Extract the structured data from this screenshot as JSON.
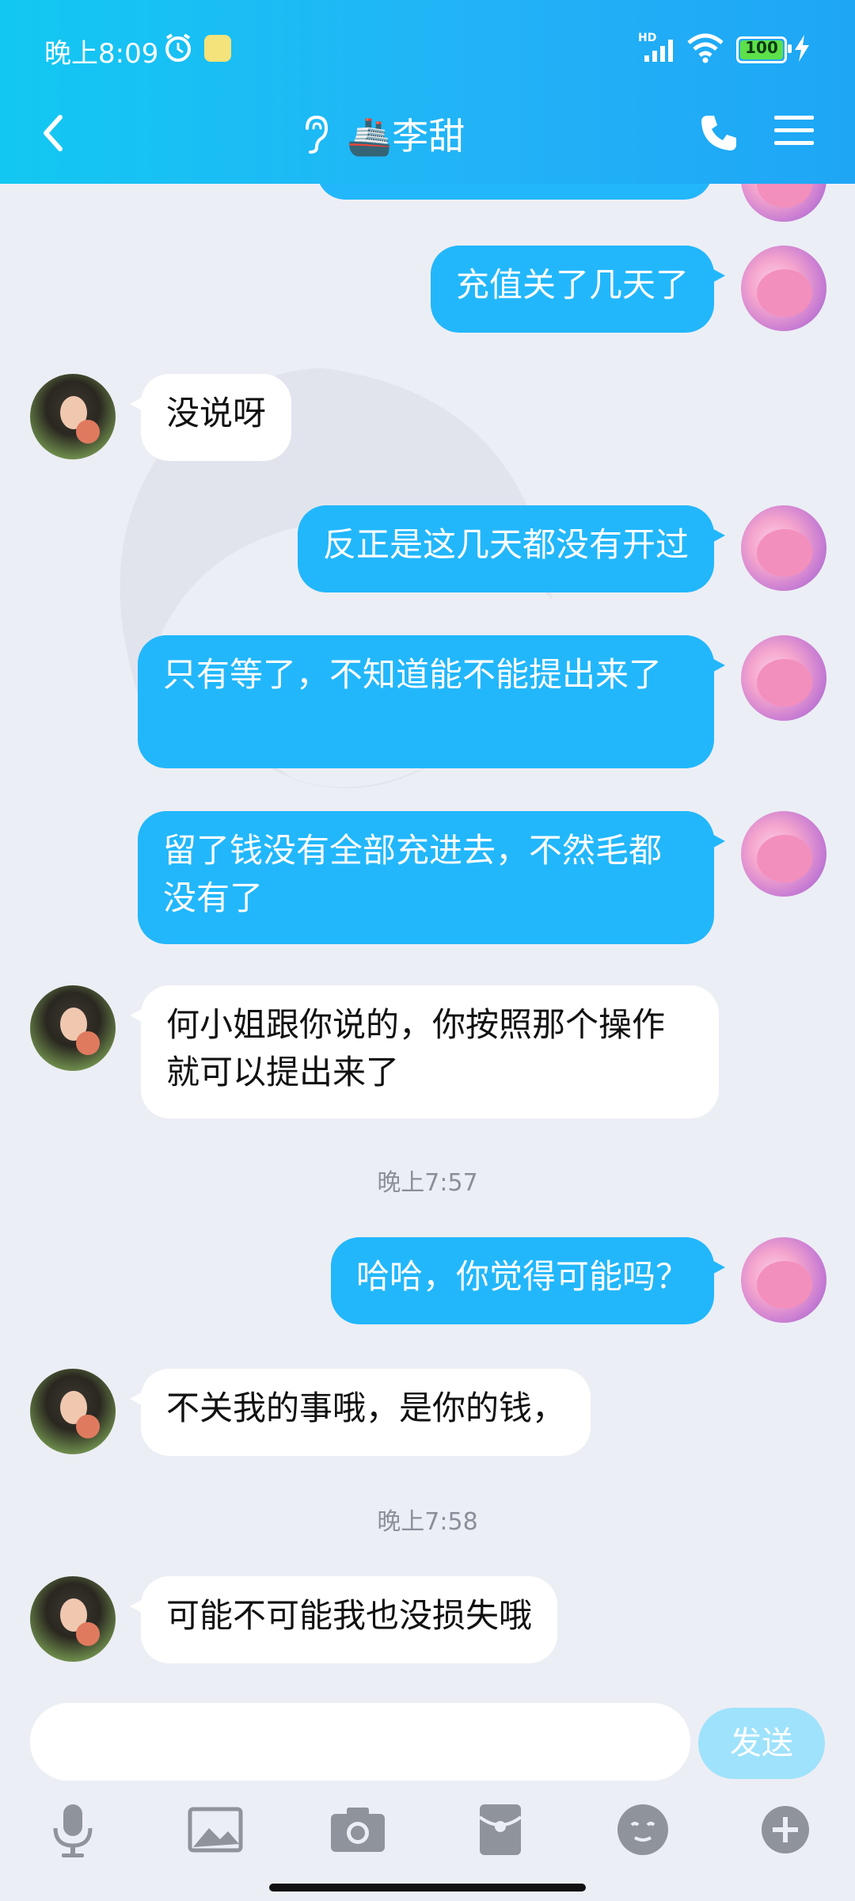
{
  "status_bar": {
    "time": "晚上8:09",
    "network": "HD",
    "battery": "100"
  },
  "header": {
    "title": "🚢李甜"
  },
  "messages": [
    {
      "from": "self",
      "text": "充值关了几天了"
    },
    {
      "from": "other",
      "text": "没说呀"
    },
    {
      "from": "self",
      "text": "反正是这几天都没有开过"
    },
    {
      "from": "self",
      "text": "只有等了，不知道能不能提出来了"
    },
    {
      "from": "self",
      "text": "留了钱没有全部充进去，不然毛都没有了"
    },
    {
      "from": "other",
      "text": "何小姐跟你说的，你按照那个操作就可以提出来了"
    },
    {
      "timestamp": "晚上7:57"
    },
    {
      "from": "self",
      "text": "哈哈，你觉得可能吗？"
    },
    {
      "from": "other",
      "text": "不关我的事哦，是你的钱，"
    },
    {
      "timestamp": "晚上7:58"
    },
    {
      "from": "other",
      "text": "可能不可能我也没损失哦"
    }
  ],
  "input": {
    "placeholder": "",
    "send_label": "发送"
  },
  "colors": {
    "header": "#1fb3f7",
    "self_bubble": "#22b7fb",
    "other_bubble": "#ffffff",
    "background": "#eceef5"
  },
  "toolbar_icons": [
    "microphone-icon",
    "image-icon",
    "camera-icon",
    "red-packet-icon",
    "emoji-icon",
    "plus-icon"
  ]
}
